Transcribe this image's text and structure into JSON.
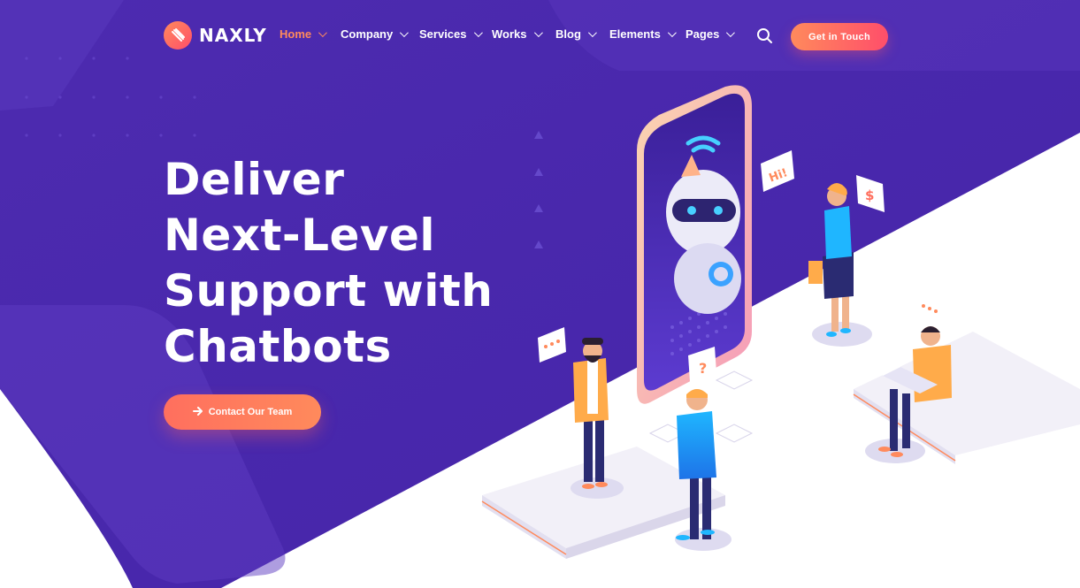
{
  "brand": {
    "name": "NAXLY",
    "colors": {
      "primary": "#4a26ab",
      "primary_dark": "#3f1f9e",
      "accent": "#ff8a5c",
      "accent_pink": "#ff4e6a",
      "white": "#ffffff"
    }
  },
  "header": {
    "nav": [
      {
        "label": "Home",
        "active": true
      },
      {
        "label": "Company",
        "active": false
      },
      {
        "label": "Services",
        "active": false
      },
      {
        "label": "Works",
        "active": false
      },
      {
        "label": "Blog",
        "active": false
      },
      {
        "label": "Elements",
        "active": false
      },
      {
        "label": "Pages",
        "active": false
      }
    ],
    "search_icon": "search-icon",
    "cta_label": "Get in Touch"
  },
  "hero": {
    "title_lines": [
      "Deliver",
      "Next-Level",
      "Support with",
      "Chatbots"
    ],
    "cta_label": "Contact Our Team",
    "cta_icon": "arrow-right-icon"
  },
  "illustration": {
    "bubbles": [
      "Hi!",
      "$",
      "?",
      "..."
    ]
  }
}
